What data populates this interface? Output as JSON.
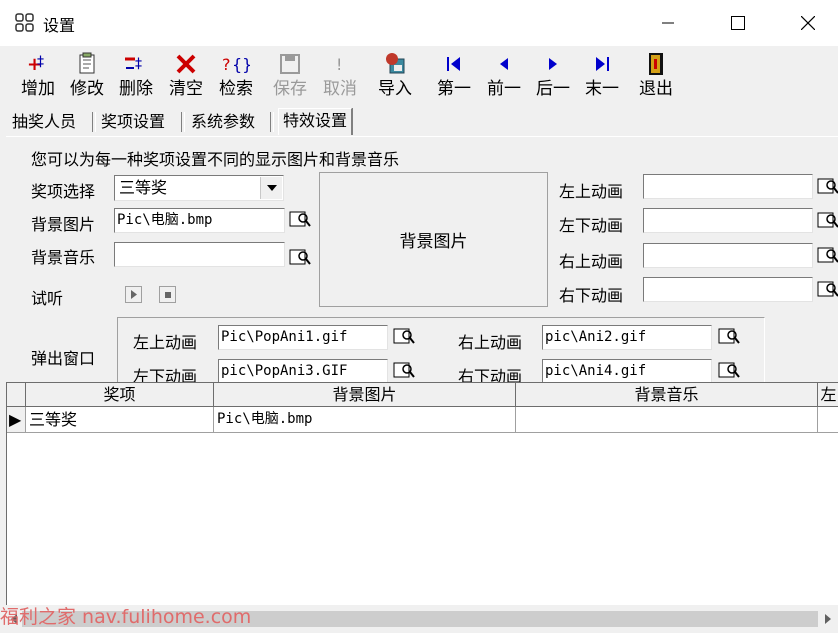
{
  "window": {
    "title": "设置",
    "controls": {
      "minimize": "—",
      "maximize": "☐",
      "close": "✕"
    }
  },
  "toolbar": [
    {
      "id": "add",
      "label": "增加",
      "icon": "add-icon",
      "enabled": true
    },
    {
      "id": "edit",
      "label": "修改",
      "icon": "edit-icon",
      "enabled": true
    },
    {
      "id": "delete",
      "label": "删除",
      "icon": "delete-icon",
      "enabled": true
    },
    {
      "id": "clear",
      "label": "清空",
      "icon": "clear-icon",
      "enabled": true
    },
    {
      "id": "search",
      "label": "检索",
      "icon": "search-icon",
      "enabled": true
    },
    {
      "id": "save",
      "label": "保存",
      "icon": "save-icon",
      "enabled": false
    },
    {
      "id": "cancel",
      "label": "取消",
      "icon": "cancel-icon",
      "enabled": false
    },
    {
      "id": "import",
      "label": "导入",
      "icon": "import-icon",
      "enabled": true
    },
    {
      "id": "first",
      "label": "第一",
      "icon": "first-icon",
      "enabled": true
    },
    {
      "id": "prev",
      "label": "前一",
      "icon": "prev-icon",
      "enabled": true
    },
    {
      "id": "next",
      "label": "后一",
      "icon": "next-icon",
      "enabled": true
    },
    {
      "id": "last",
      "label": "末一",
      "icon": "last-icon",
      "enabled": true
    },
    {
      "id": "exit",
      "label": "退出",
      "icon": "exit-icon",
      "enabled": true
    }
  ],
  "tabs": [
    {
      "label": "抽奖人员"
    },
    {
      "label": "奖项设置"
    },
    {
      "label": "系统参数"
    },
    {
      "label": "特效设置",
      "active": true
    }
  ],
  "form": {
    "intro": "您可以为每一种奖项设置不同的显示图片和背景音乐",
    "prize_label": "奖项选择",
    "prize_value": "三等奖",
    "bg_image_label": "背景图片",
    "bg_image_value": "Pic\\电脑.bmp",
    "bg_music_label": "背景音乐",
    "bg_music_value": "",
    "listen_label": "试听",
    "preview_label": "背景图片",
    "anim_top_left_label": "左上动画",
    "anim_bottom_left_label": "左下动画",
    "anim_top_right_label": "右上动画",
    "anim_bottom_right_label": "右下动画",
    "anim_top_left_value": "",
    "anim_bottom_left_value": "",
    "anim_top_right_value": "",
    "anim_bottom_right_value": "",
    "popup_label": "弹出窗口",
    "popup_top_left_label": "左上动画",
    "popup_top_left_value": "Pic\\PopAni1.gif",
    "popup_bottom_left_label": "左下动画",
    "popup_bottom_left_value": "pic\\PopAni3.GIF",
    "popup_top_right_label": "右上动画",
    "popup_top_right_value": "pic\\Ani2.gif",
    "popup_bottom_right_label": "右下动画",
    "popup_bottom_right_value": "pic\\Ani4.gif"
  },
  "grid": {
    "columns": [
      "奖项",
      "背景图片",
      "背景音乐",
      "左"
    ],
    "rows": [
      {
        "prize": "三等奖",
        "bg_image": "Pic\\电脑.bmp",
        "bg_music": "",
        "anim": ""
      }
    ],
    "row_indicator": "▶"
  },
  "watermark": "福利之家 nav.fulihome.com",
  "colors": {
    "blue_nav": "#0000cc",
    "red_delete": "#cc0000",
    "watermark": "#e06b6b"
  }
}
